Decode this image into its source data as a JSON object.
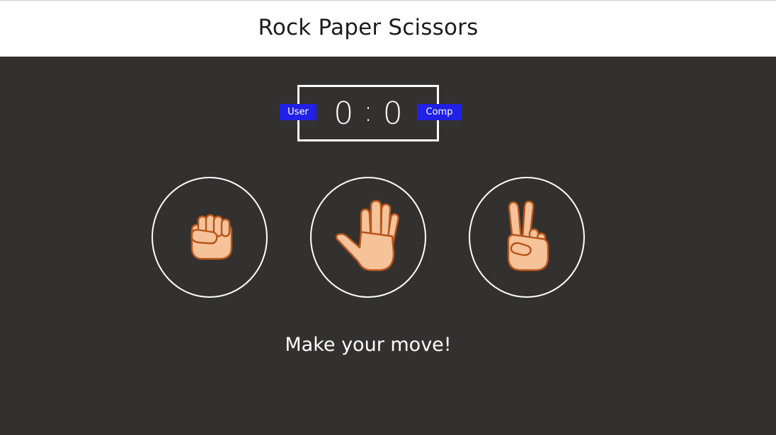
{
  "header": {
    "title": "Rock Paper Scissors"
  },
  "scoreboard": {
    "user_label": "User",
    "comp_label": "Comp",
    "user_score": "0",
    "separator": ":",
    "comp_score": "0"
  },
  "choices": [
    {
      "id": "rock",
      "icon": "fist-icon"
    },
    {
      "id": "paper",
      "icon": "open-hand-icon"
    },
    {
      "id": "scissors",
      "icon": "victory-hand-icon"
    }
  ],
  "message": "Make your move!",
  "colors": {
    "background": "#333130",
    "header_background": "#ffffff",
    "badge": "#2020e6",
    "skin": "#f6c29a",
    "skin_outline": "#b5561c"
  }
}
